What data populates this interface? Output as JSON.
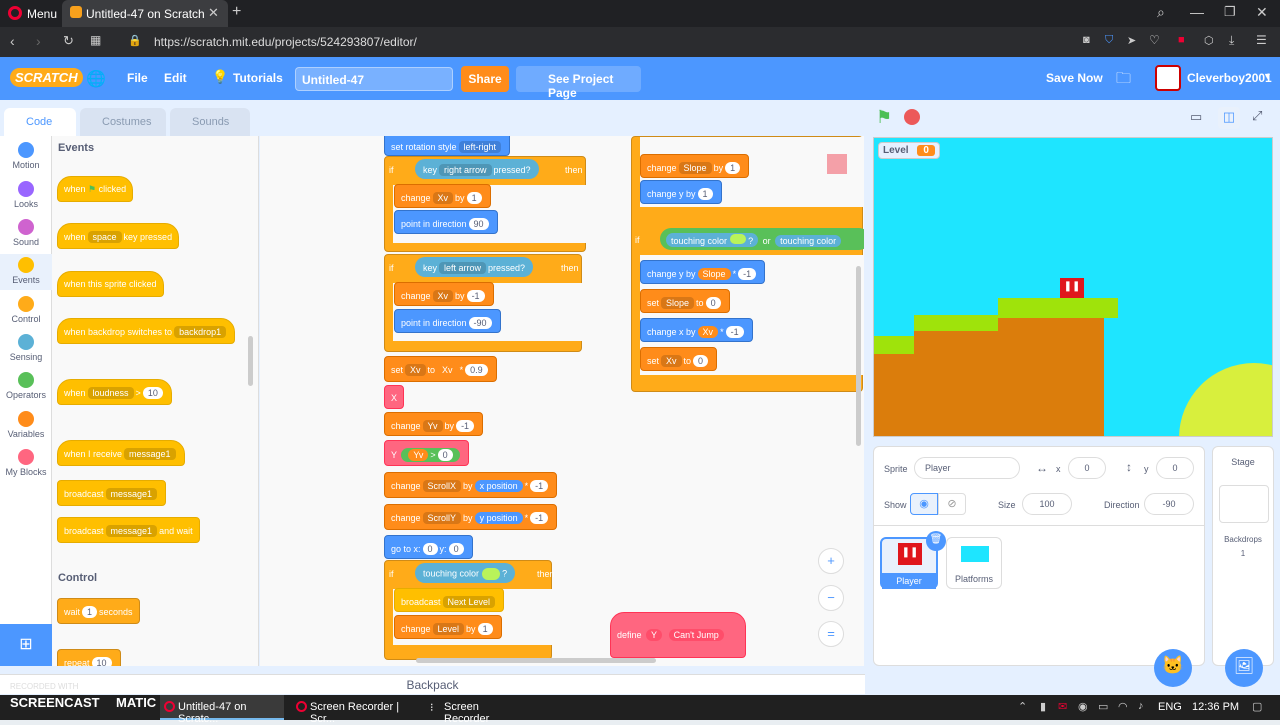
{
  "browser": {
    "menu_label": "Menu",
    "tab_title": "Untitled-47 on Scratch",
    "url": "https://scratch.mit.edu/projects/524293807/editor/"
  },
  "menubar": {
    "logo": "SCRATCH",
    "file": "File",
    "edit": "Edit",
    "tutorials": "Tutorials",
    "project_title": "Untitled-47",
    "share": "Share",
    "see_project": "See Project Page",
    "save_now": "Save Now",
    "username": "Cleverboy2001"
  },
  "tabs": {
    "code": "Code",
    "costumes": "Costumes",
    "sounds": "Sounds"
  },
  "categories": [
    {
      "label": "Motion",
      "color": "#4c97ff"
    },
    {
      "label": "Looks",
      "color": "#9966ff"
    },
    {
      "label": "Sound",
      "color": "#cf63cf"
    },
    {
      "label": "Events",
      "color": "#ffbf00"
    },
    {
      "label": "Control",
      "color": "#ffab19"
    },
    {
      "label": "Sensing",
      "color": "#5cb1d6"
    },
    {
      "label": "Operators",
      "color": "#59c059"
    },
    {
      "label": "Variables",
      "color": "#ff8c1a"
    },
    {
      "label": "My Blocks",
      "color": "#ff6680"
    }
  ],
  "palette": {
    "events_heading": "Events",
    "when_flag": "when",
    "clicked": "clicked",
    "when_key": "when",
    "key_space": "space",
    "key_pressed": "key pressed",
    "sprite_clicked": "when this sprite clicked",
    "backdrop_switches": "when backdrop switches to",
    "backdrop1": "backdrop1",
    "when_loudness": "when",
    "loudness": "loudness",
    "gt": ">",
    "loud_val": "10",
    "receive": "when I receive",
    "message1": "message1",
    "broadcast": "broadcast",
    "broadcast_wait_msg": "message1",
    "and_wait": "and wait",
    "control_heading": "Control",
    "wait": "wait",
    "wait_val": "1",
    "seconds": "seconds",
    "repeat": "repeat",
    "repeat_val": "10"
  },
  "scripts": {
    "set_rotation": "set rotation style",
    "left_right": "left-right",
    "if1": "if",
    "key1": "key",
    "right_arrow": "right arrow",
    "pressed": "pressed?",
    "then": "then",
    "change1": "change",
    "xv": "Xv",
    "by": "by",
    "one": "1",
    "point_dir": "point in direction",
    "ninety": "90",
    "left_arrow": "left arrow",
    "neg1": "-1",
    "neg90": "-90",
    "set": "set",
    "to": "to",
    "times": "*",
    "point9": "0.9",
    "x_label": "X",
    "yv": "Yv",
    "y_label": "Y",
    "zero": "0",
    "scrollx": "ScrollX",
    "xpos": "x position",
    "scrolly": "ScrollY",
    "ypos": "y position",
    "goto": "go to x:",
    "y_colon": "y:",
    "touching": "touching color",
    "q": "?",
    "broadcast": "broadcast",
    "next_level": "Next Level",
    "level": "Level",
    "slope": "Slope",
    "change_y_by": "change y by",
    "or": "or",
    "change_x_by": "change x by",
    "define": "define",
    "cant_jump": "Can't Jump"
  },
  "stage": {
    "level_label": "Level",
    "level_value": "0"
  },
  "sprite_info": {
    "sprite_label": "Sprite",
    "sprite_name": "Player",
    "x_label": "x",
    "x_value": "0",
    "y_label": "y",
    "y_value": "0",
    "show_label": "Show",
    "size_label": "Size",
    "size_value": "100",
    "direction_label": "Direction",
    "direction_value": "-90",
    "sprites": [
      "Player",
      "Platforms"
    ]
  },
  "stage_pane": {
    "title": "Stage",
    "backdrops_label": "Backdrops",
    "backdrops_count": "1"
  },
  "backpack": "Backpack",
  "taskbar": {
    "item1": "Untitled-47 on Scratc...",
    "item2": "Screen Recorder | Scr...",
    "item3": "Screen Recorder",
    "lang": "ENG",
    "time": "12:36 PM",
    "watermark_top": "RECORDED WITH",
    "watermark": "SCREENCAST",
    "watermark2": "MATIC"
  }
}
